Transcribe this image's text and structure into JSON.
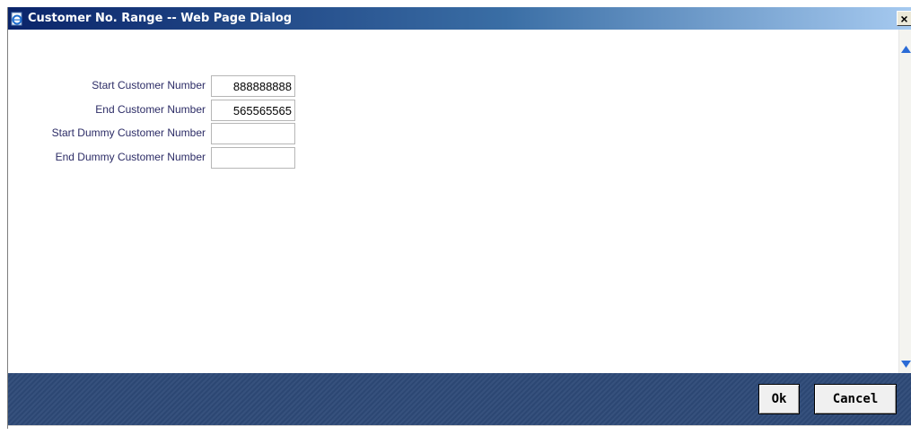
{
  "window": {
    "title": "Customer No. Range -- Web Page Dialog",
    "close_glyph": "×"
  },
  "form": {
    "start_customer_number": {
      "label": "Start Customer Number",
      "value": "888888888"
    },
    "end_customer_number": {
      "label": "End Customer Number",
      "value": "565565565"
    },
    "start_dummy_customer_number": {
      "label": "Start Dummy Customer Number",
      "value": ""
    },
    "end_dummy_customer_number": {
      "label": "End Dummy Customer Number",
      "value": ""
    }
  },
  "footer": {
    "ok_label": "Ok",
    "cancel_label": "Cancel"
  },
  "colors": {
    "title_bar": "#0a246a",
    "footer": "#2e4a78",
    "label_text": "#2c2c66"
  },
  "icons": {
    "title": "ie-page-icon",
    "close": "close-icon",
    "scroll_up": "scroll-up-arrow-icon",
    "scroll_down": "scroll-down-arrow-icon"
  }
}
